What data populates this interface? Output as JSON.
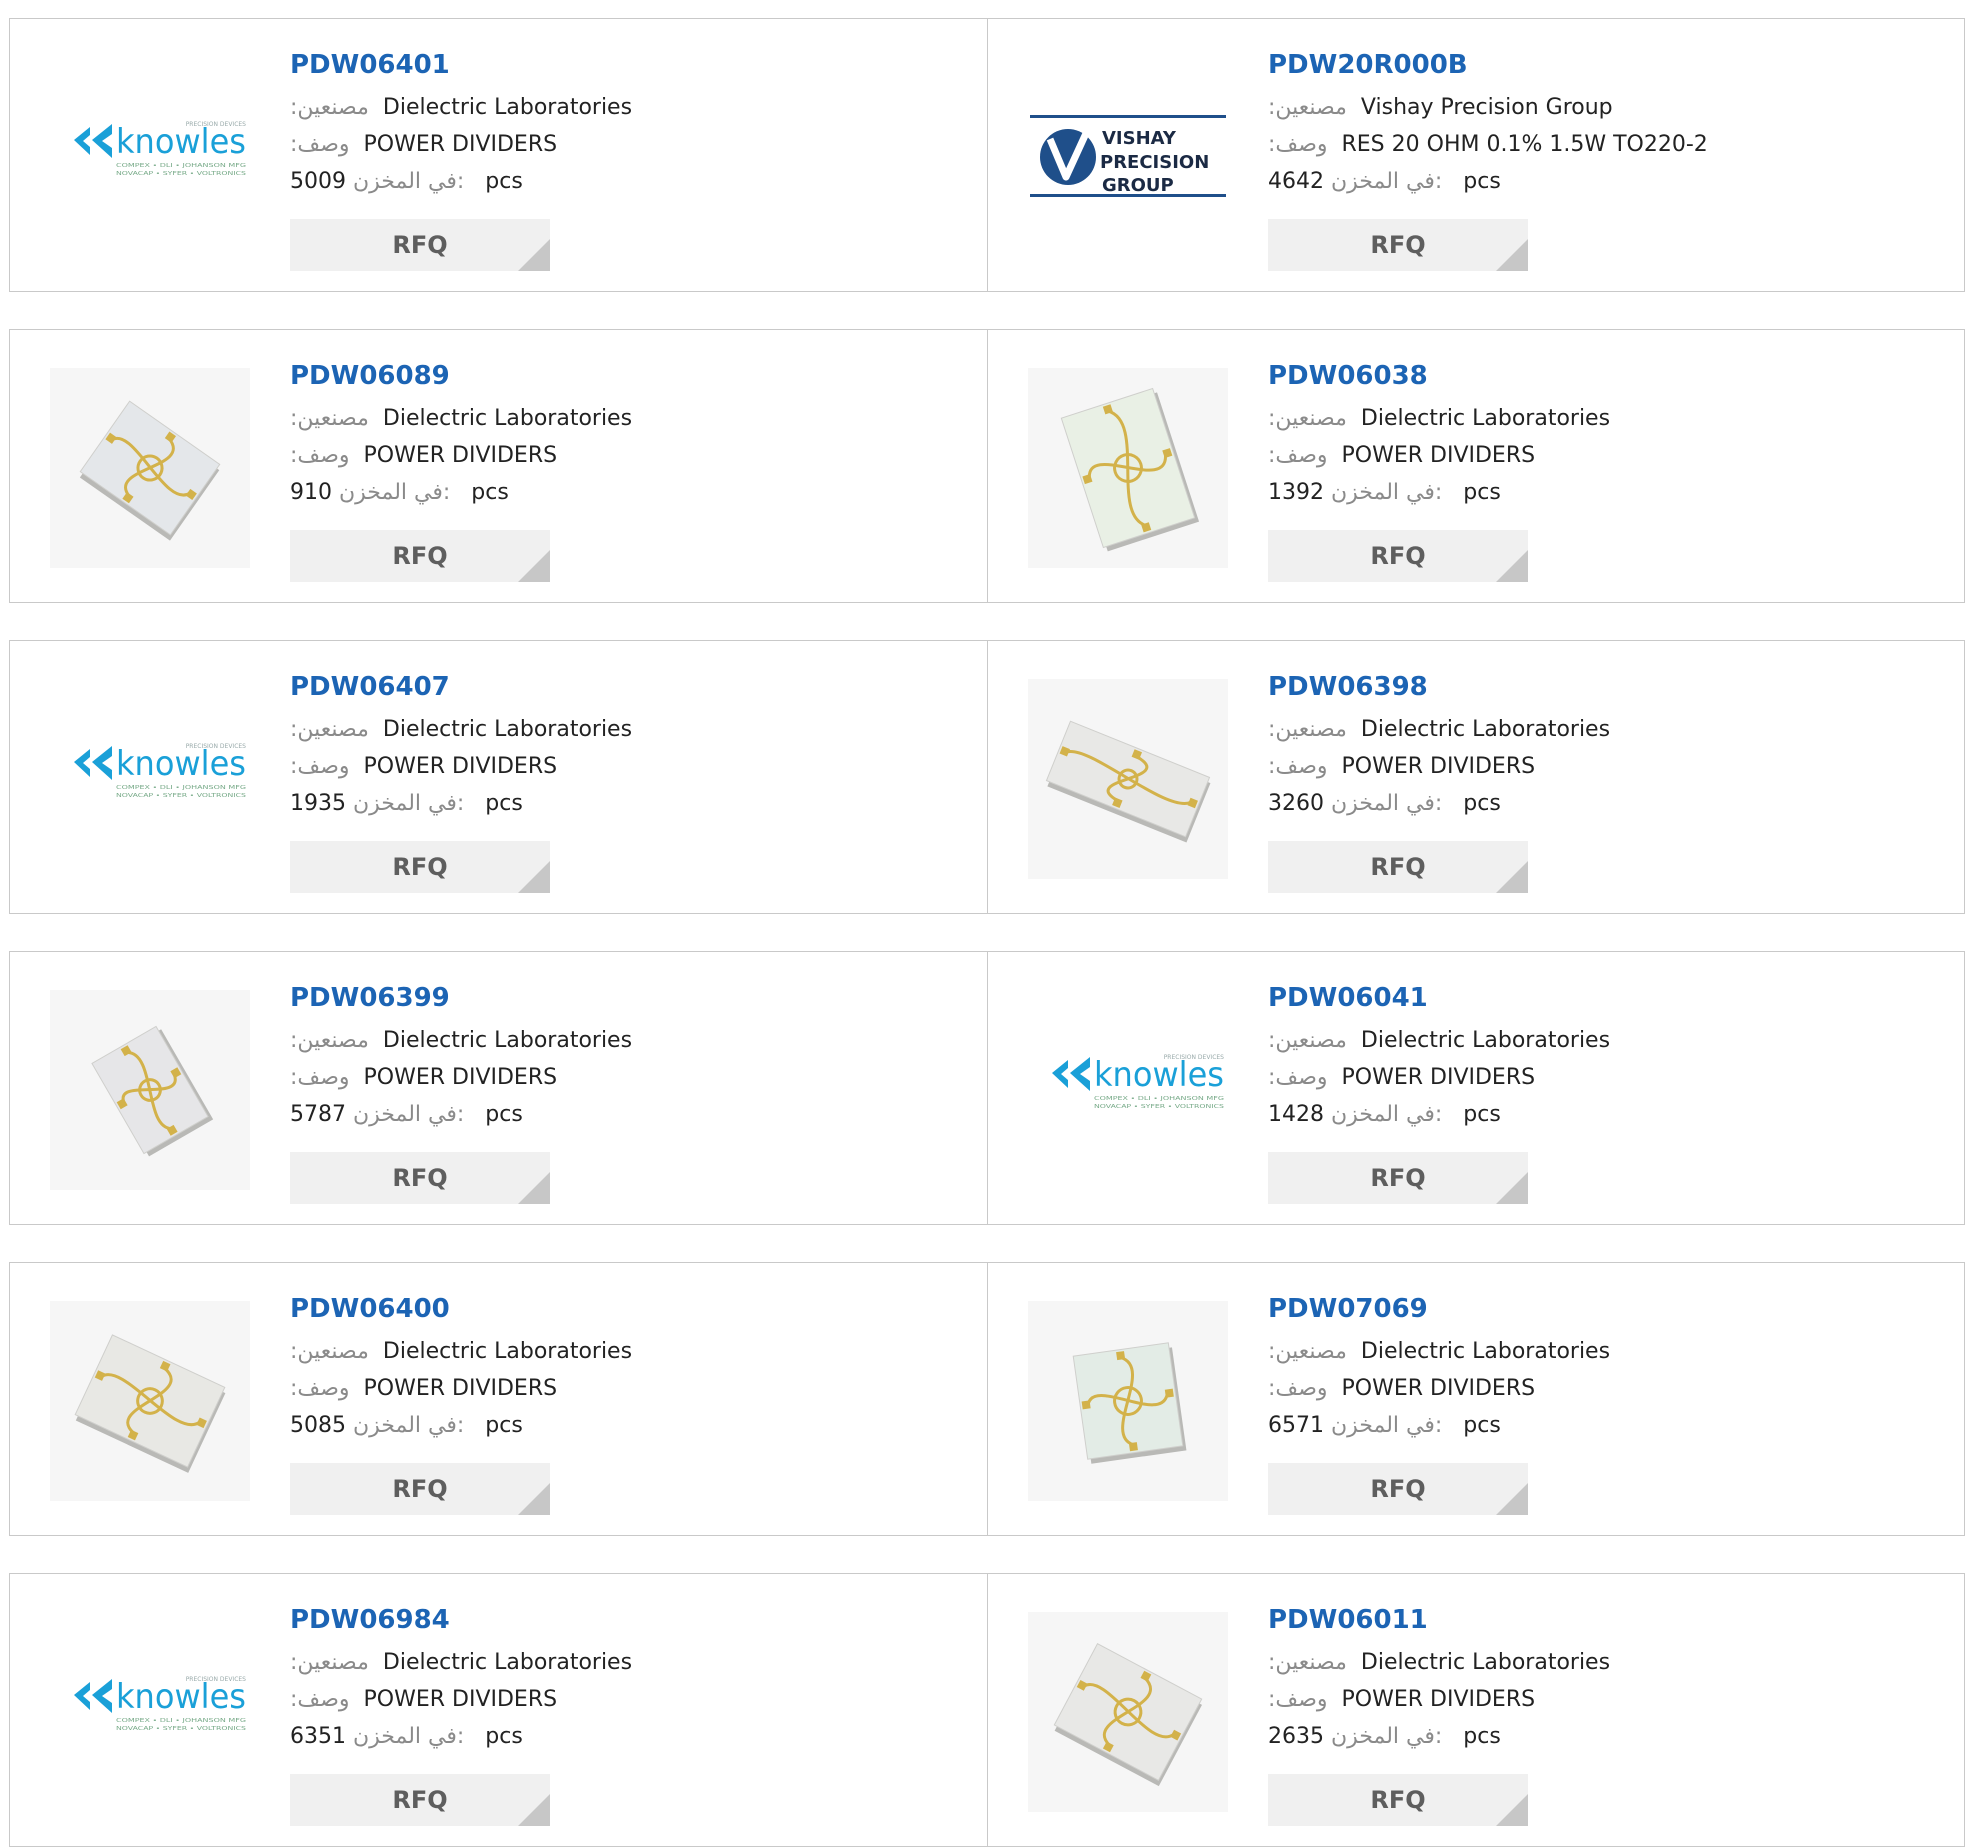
{
  "labels": {
    "manufacturer": "مصنعين",
    "description": "وصف",
    "stock": "في المخزن",
    "unit": "pcs",
    "rfq": "RFQ"
  },
  "logos": {
    "knowles": {
      "wordmark": "knowles",
      "tagline": "PRECISION DEVICES",
      "sub1": "COMPEX • DLI • JOHANSON MFG",
      "sub2": "NOVACAP • SYFER • VOLTRONICS",
      "color": "#1aa0d8"
    },
    "vishay": {
      "line1": "VISHAY",
      "line2": "PRECISION",
      "line3": "GROUP",
      "color": "#1f4f8a"
    }
  },
  "products": [
    {
      "part": "PDW06401",
      "manufacturer": "Dielectric Laboratories",
      "description": "POWER DIVIDERS",
      "stock": "5009",
      "image": "knowles-logo"
    },
    {
      "part": "PDW20R000B",
      "manufacturer": "Vishay Precision Group",
      "description": "RES 20 OHM 0.1% 1.5W TO220-2",
      "stock": "4642",
      "image": "vishay-logo"
    },
    {
      "part": "PDW06089",
      "manufacturer": "Dielectric Laboratories",
      "description": "POWER DIVIDERS",
      "stock": "910",
      "image": "chip-photo"
    },
    {
      "part": "PDW06038",
      "manufacturer": "Dielectric Laboratories",
      "description": "POWER DIVIDERS",
      "stock": "1392",
      "image": "chip-photo"
    },
    {
      "part": "PDW06407",
      "manufacturer": "Dielectric Laboratories",
      "description": "POWER DIVIDERS",
      "stock": "1935",
      "image": "knowles-logo"
    },
    {
      "part": "PDW06398",
      "manufacturer": "Dielectric Laboratories",
      "description": "POWER DIVIDERS",
      "stock": "3260",
      "image": "chip-photo"
    },
    {
      "part": "PDW06399",
      "manufacturer": "Dielectric Laboratories",
      "description": "POWER DIVIDERS",
      "stock": "5787",
      "image": "chip-photo"
    },
    {
      "part": "PDW06041",
      "manufacturer": "Dielectric Laboratories",
      "description": "POWER DIVIDERS",
      "stock": "1428",
      "image": "knowles-logo"
    },
    {
      "part": "PDW06400",
      "manufacturer": "Dielectric Laboratories",
      "description": "POWER DIVIDERS",
      "stock": "5085",
      "image": "chip-photo"
    },
    {
      "part": "PDW07069",
      "manufacturer": "Dielectric Laboratories",
      "description": "POWER DIVIDERS",
      "stock": "6571",
      "image": "chip-photo"
    },
    {
      "part": "PDW06984",
      "manufacturer": "Dielectric Laboratories",
      "description": "POWER DIVIDERS",
      "stock": "6351",
      "image": "knowles-logo"
    },
    {
      "part": "PDW06011",
      "manufacturer": "Dielectric Laboratories",
      "description": "POWER DIVIDERS",
      "stock": "2635",
      "image": "chip-photo"
    }
  ]
}
